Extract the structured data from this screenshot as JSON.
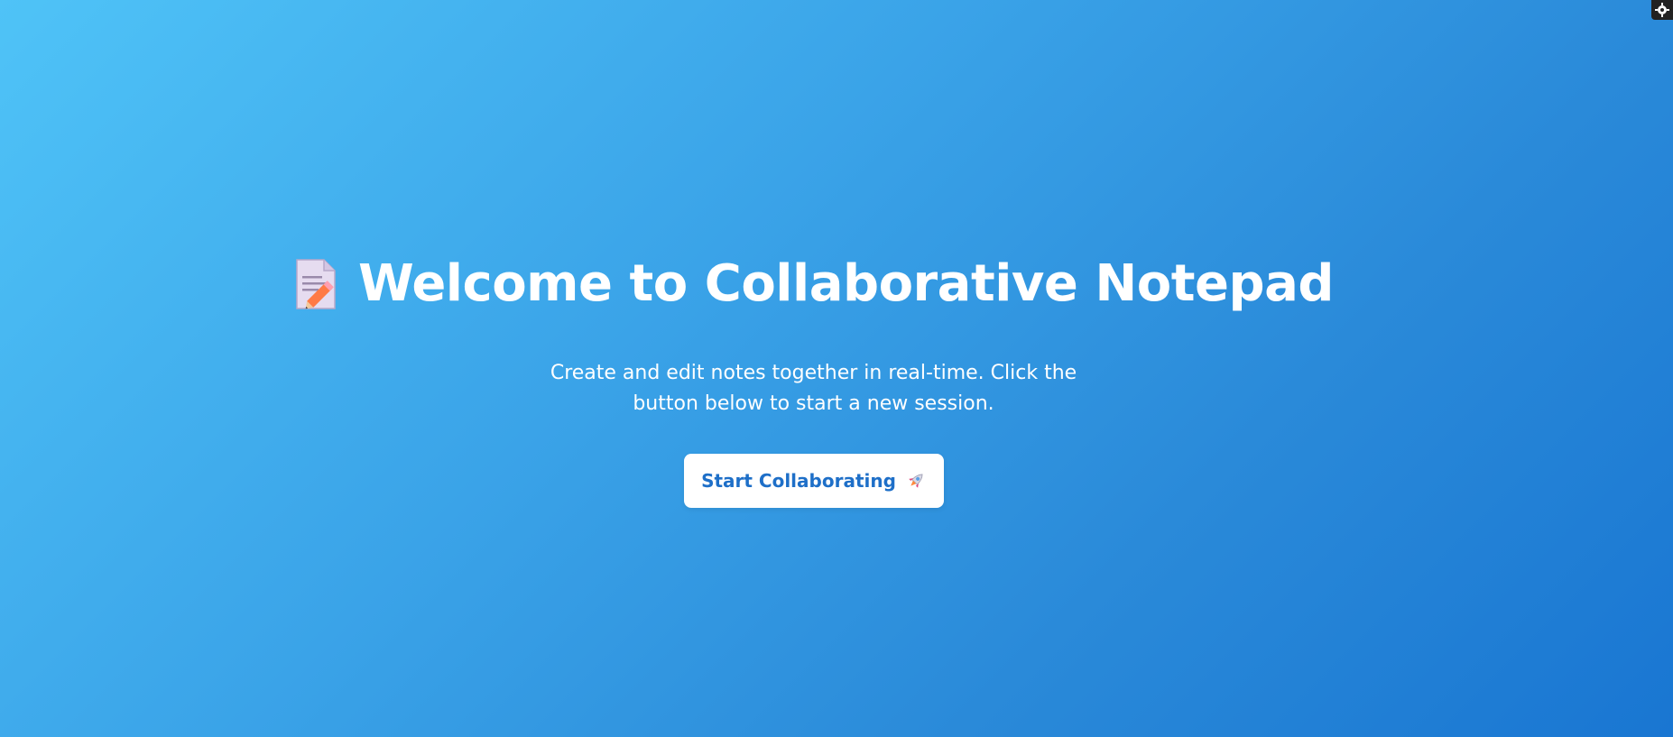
{
  "hero": {
    "title_icon": "memo-pencil-icon",
    "title": "Welcome to Collaborative Notepad",
    "subtitle_line1": "Create and edit notes together in real-time. Click the",
    "subtitle_line2": "button below to start a new session.",
    "button_label": "Start Collaborating",
    "button_icon": "rocket-icon"
  },
  "corner": {
    "icon": "gear-icon"
  },
  "colors": {
    "gradient_start": "#4fc3f7",
    "gradient_end": "#1976d2",
    "button_text": "#1e6fc8",
    "button_bg": "#ffffff"
  }
}
